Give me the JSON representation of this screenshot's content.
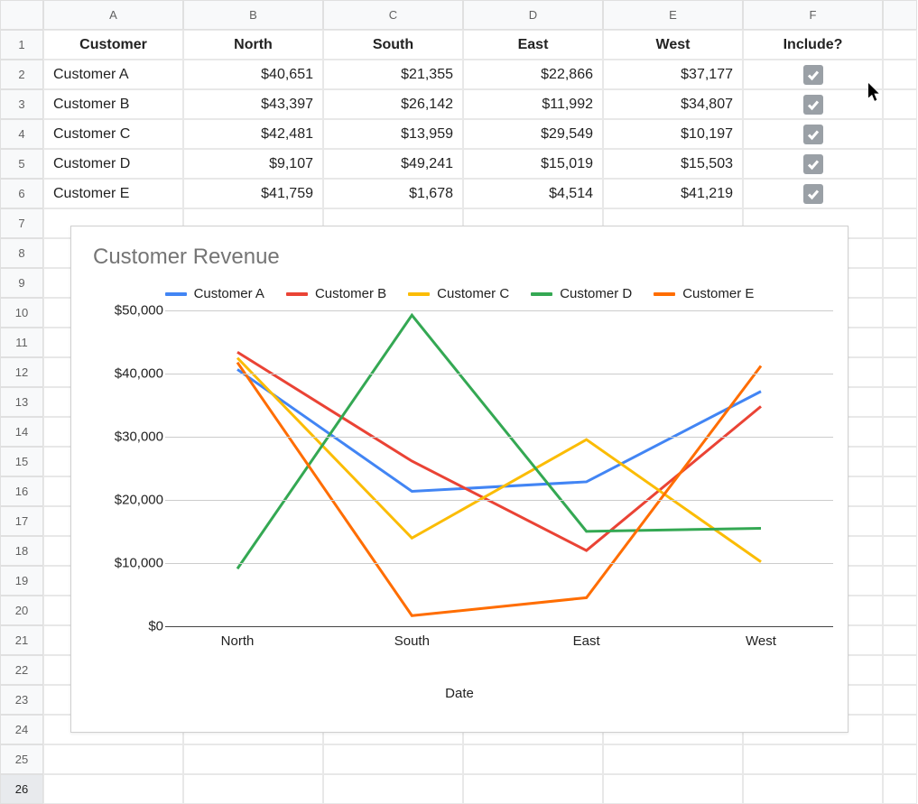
{
  "columns": [
    "A",
    "B",
    "C",
    "D",
    "E",
    "F"
  ],
  "row_numbers": [
    1,
    2,
    3,
    4,
    5,
    6,
    7,
    8,
    9,
    10,
    11,
    12,
    13,
    14,
    15,
    16,
    17,
    18,
    19,
    20,
    21,
    22,
    23,
    24,
    25,
    26
  ],
  "selected_row": 26,
  "header_row": {
    "A": "Customer",
    "B": "North",
    "C": "South",
    "D": "East",
    "E": "West",
    "F": "Include?"
  },
  "data_rows": [
    {
      "A": "Customer A",
      "B": "$40,651",
      "C": "$21,355",
      "D": "$22,866",
      "E": "$37,177",
      "F": true
    },
    {
      "A": "Customer B",
      "B": "$43,397",
      "C": "$26,142",
      "D": "$11,992",
      "E": "$34,807",
      "F": true
    },
    {
      "A": "Customer C",
      "B": "$42,481",
      "C": "$13,959",
      "D": "$29,549",
      "E": "$10,197",
      "F": true
    },
    {
      "A": "Customer D",
      "B": "$9,107",
      "C": "$49,241",
      "D": "$15,019",
      "E": "$15,503",
      "F": true
    },
    {
      "A": "Customer E",
      "B": "$41,759",
      "C": "$1,678",
      "D": "$4,514",
      "E": "$41,219",
      "F": true
    }
  ],
  "chart_data": {
    "type": "line",
    "title": "Customer Revenue",
    "xlabel": "Date",
    "ylabel": "",
    "categories": [
      "North",
      "South",
      "East",
      "West"
    ],
    "ylim": [
      0,
      50000
    ],
    "yticks": [
      "$0",
      "$10,000",
      "$20,000",
      "$30,000",
      "$40,000",
      "$50,000"
    ],
    "series": [
      {
        "name": "Customer A",
        "color": "#4285F4",
        "values": [
          40651,
          21355,
          22866,
          37177
        ]
      },
      {
        "name": "Customer B",
        "color": "#EA4335",
        "values": [
          43397,
          26142,
          11992,
          34807
        ]
      },
      {
        "name": "Customer C",
        "color": "#FBBC04",
        "values": [
          42481,
          13959,
          29549,
          10197
        ]
      },
      {
        "name": "Customer D",
        "color": "#34A853",
        "values": [
          9107,
          49241,
          15019,
          15503
        ]
      },
      {
        "name": "Customer E",
        "color": "#FF6D00",
        "values": [
          41759,
          1678,
          4514,
          41219
        ]
      }
    ]
  }
}
